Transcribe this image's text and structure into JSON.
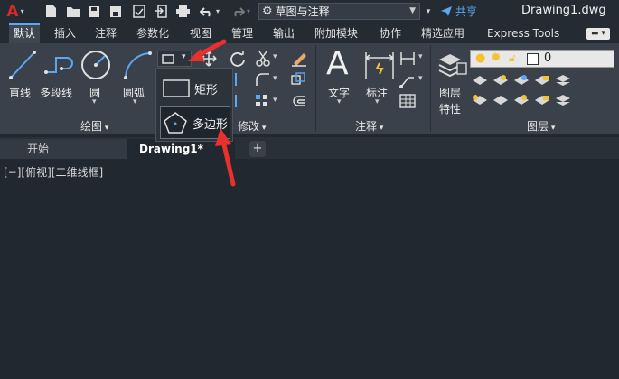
{
  "title_bar": {
    "workspace": "草图与注释",
    "share_label": "共享",
    "document_title": "Drawing1.dwg"
  },
  "ribbon_tabs": [
    "默认",
    "插入",
    "注释",
    "参数化",
    "视图",
    "管理",
    "输出",
    "附加模块",
    "协作",
    "精选应用",
    "Express Tools"
  ],
  "active_tab": "默认",
  "ribbon": {
    "draw": {
      "line": "直线",
      "polyline": "多段线",
      "circle": "圆",
      "arc": "圆弧",
      "panel_label": "绘图"
    },
    "modify": {
      "panel_label": "修改"
    },
    "annotation": {
      "text": "文字",
      "dimension": "标注",
      "panel_label": "注释"
    },
    "layers": {
      "layer_properties_line1": "图层",
      "layer_properties_line2": "特性",
      "current_layer": "0",
      "panel_label": "图层"
    }
  },
  "flyout": {
    "rectangle": "矩形",
    "polygon": "多边形"
  },
  "file_tabs": {
    "start": "开始",
    "drawing": "Drawing1*",
    "add": "+"
  },
  "viewport_label": "[−][俯视][二维线框]",
  "colors": {
    "accent": "#5aa7f2",
    "arrow": "#e8302c",
    "app_logo": "#d42a2a",
    "bulb": "#f2c230"
  }
}
